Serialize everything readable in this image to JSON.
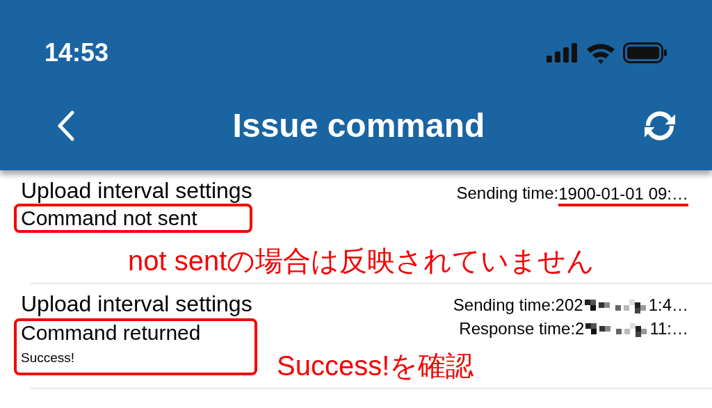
{
  "status_bar": {
    "time": "14:53"
  },
  "nav": {
    "title": "Issue command"
  },
  "commands": [
    {
      "name": "Upload interval settings",
      "status": "Command not sent",
      "highlighted": true,
      "times": [
        {
          "label": "Sending time:",
          "value": "1900-01-01 09:…",
          "underlined": true,
          "redacted": false
        }
      ],
      "note": "not sentの場合は反映されていません"
    },
    {
      "name": "Upload interval settings",
      "status": "Command returned",
      "result": "Success!",
      "highlighted": true,
      "times": [
        {
          "label": "Sending time:",
          "value": "202",
          "value_end": "1:4…",
          "underlined": false,
          "redacted": true
        },
        {
          "label": "Response time:",
          "value": "2",
          "value_end": "11:…",
          "underlined": false,
          "redacted": true
        }
      ],
      "note": "Success!を確認"
    }
  ]
}
